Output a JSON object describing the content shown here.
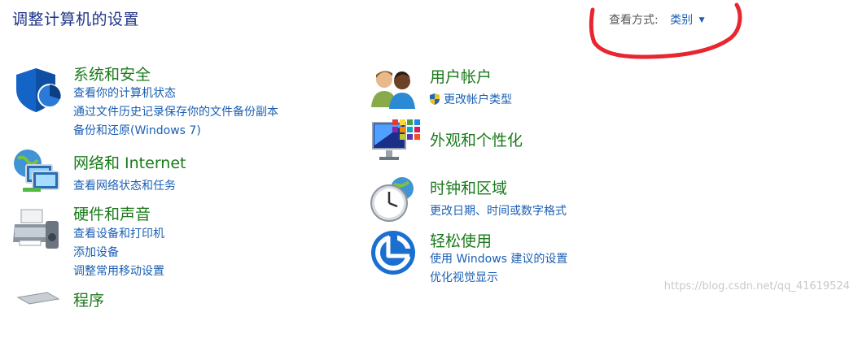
{
  "header": {
    "title": "调整计算机的设置",
    "view_by_label": "查看方式:",
    "view_by_value": "类别",
    "view_by_arrow": "▼"
  },
  "categories_left": [
    {
      "title": "系统和安全",
      "icon": "shield-icon",
      "links": [
        "查看你的计算机状态",
        "通过文件历史记录保存你的文件备份副本",
        "备份和还原(Windows 7)"
      ]
    },
    {
      "title": "网络和 Internet",
      "icon": "network-icon",
      "links": [
        "查看网络状态和任务"
      ]
    },
    {
      "title": "硬件和声音",
      "icon": "printer-icon",
      "links": [
        "查看设备和打印机",
        "添加设备",
        "调整常用移动设置"
      ]
    },
    {
      "title": "程序",
      "icon": "programs-icon",
      "links": []
    }
  ],
  "categories_right": [
    {
      "title": "用户帐户",
      "icon": "users-icon",
      "links": [
        "更改帐户类型"
      ]
    },
    {
      "title": "外观和个性化",
      "icon": "monitor-icon",
      "links": []
    },
    {
      "title": "时钟和区域",
      "icon": "clock-icon",
      "links": [
        "更改日期、时间或数字格式"
      ]
    },
    {
      "title": "轻松使用",
      "icon": "accessibility-icon",
      "links": [
        "使用 Windows 建议的设置",
        "优化视觉显示"
      ]
    }
  ],
  "watermark": "https://blog.csdn.net/qq_41619524",
  "colors": {
    "title": "#1e3287",
    "category": "#1a7a1a",
    "link": "#1a5fb4",
    "annotation": "#e8262f"
  }
}
